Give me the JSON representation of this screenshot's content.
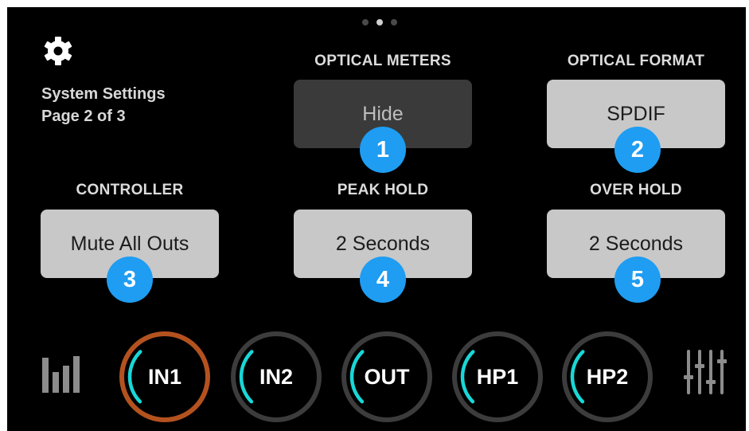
{
  "page_dots": {
    "count": 3,
    "active_index": 1
  },
  "system": {
    "title": "System Settings",
    "page": "Page 2 of 3",
    "icon": "gear-icon"
  },
  "settings": {
    "optical_meters": {
      "label": "OPTICAL METERS",
      "value": "Hide",
      "badge": "1"
    },
    "optical_format": {
      "label": "OPTICAL FORMAT",
      "value": "SPDIF",
      "badge": "2"
    },
    "controller": {
      "label": "CONTROLLER",
      "value": "Mute All Outs",
      "badge": "3"
    },
    "peak_hold": {
      "label": "PEAK HOLD",
      "value": "2 Seconds",
      "badge": "4"
    },
    "over_hold": {
      "label": "OVER HOLD",
      "value": "2 Seconds",
      "badge": "5"
    }
  },
  "channels": [
    {
      "label": "IN1",
      "selected": true,
      "level_fraction": 0.28
    },
    {
      "label": "IN2",
      "selected": false,
      "level_fraction": 0.28
    },
    {
      "label": "OUT",
      "selected": false,
      "level_fraction": 0.28
    },
    {
      "label": "HP1",
      "selected": false,
      "level_fraction": 0.28
    },
    {
      "label": "HP2",
      "selected": false,
      "level_fraction": 0.28
    }
  ],
  "bottom_icons": {
    "left": "meter-bars-icon",
    "right": "mixer-faders-icon"
  },
  "colors": {
    "background": "#000000",
    "button": "#c8c8c8",
    "button_dark": "#3a3a3a",
    "badge": "#1e9df2",
    "knob_level": "#19d7d7",
    "knob_ring": "#3c3c3c",
    "selected_ring": "#b4521f"
  }
}
